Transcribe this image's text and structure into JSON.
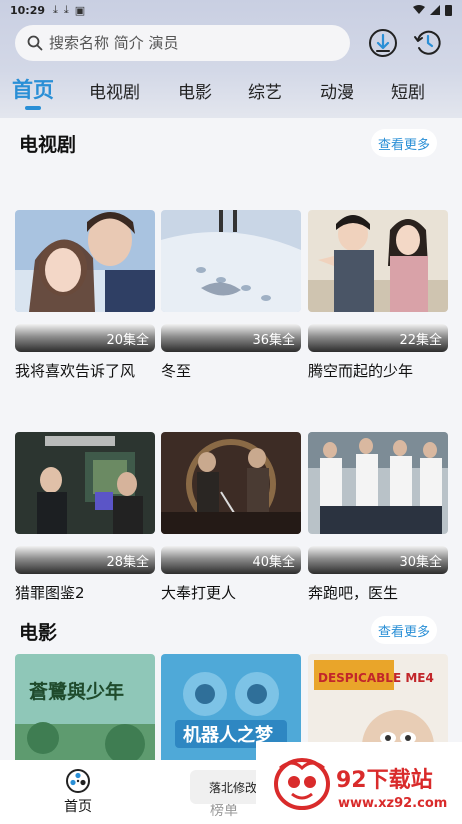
{
  "status_bar": {
    "time": "10:29"
  },
  "search": {
    "placeholder": "搜索名称 简介 演员"
  },
  "header_buttons": {
    "download_icon": "download-circle-icon",
    "history_icon": "history-clock-icon"
  },
  "tabs": [
    {
      "label": "首页",
      "active": true
    },
    {
      "label": "电视剧"
    },
    {
      "label": "电影"
    },
    {
      "label": "综艺"
    },
    {
      "label": "动漫"
    },
    {
      "label": "短剧"
    }
  ],
  "sections": {
    "tv": {
      "title": "电视剧",
      "more_label": "查看更多",
      "items": [
        {
          "title": "我将喜欢告诉了风",
          "episodes": "20集全"
        },
        {
          "title": "冬至",
          "episodes": "36集全"
        },
        {
          "title": "腾空而起的少年",
          "episodes": "22集全"
        },
        {
          "title": "猎罪图鉴2",
          "episodes": "28集全"
        },
        {
          "title": "大奉打更人",
          "episodes": "40集全"
        },
        {
          "title": "奔跑吧，医生",
          "episodes": "30集全"
        }
      ]
    },
    "movie": {
      "title": "电影",
      "more_label": "查看更多",
      "items": [
        {
          "poster_text": "蒼鷺與少年"
        },
        {
          "poster_text": "机器人之梦"
        },
        {
          "poster_text": "DESPICABLE ME4"
        }
      ]
    }
  },
  "bottom_nav": {
    "home_label": "首页",
    "rank_label": "榜单"
  },
  "toast": {
    "text": "落北修改"
  },
  "watermark": {
    "brand": "92下载站",
    "url": "www.xz92.com"
  },
  "colors": {
    "accent": "#2a8fd6",
    "watermark": "#d92b2b"
  }
}
